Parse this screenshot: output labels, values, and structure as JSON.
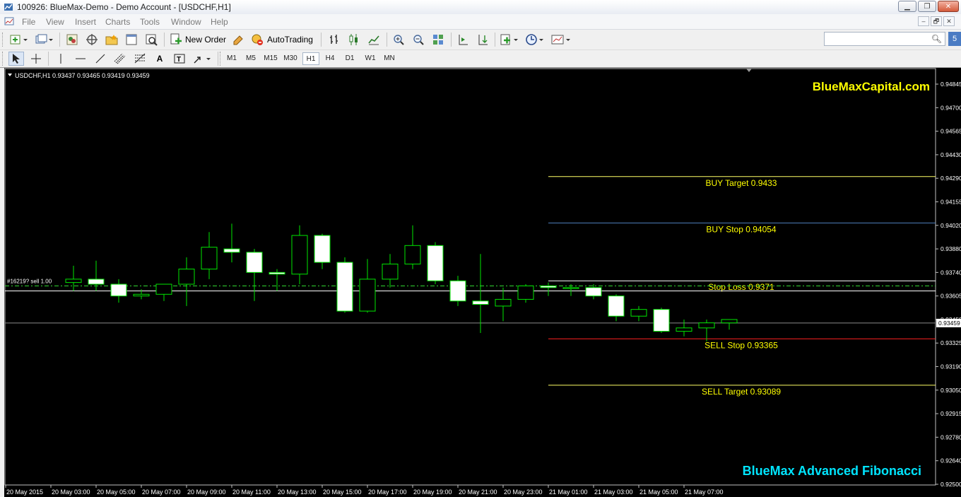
{
  "window": {
    "title": "100926: BlueMax-Demo - Demo Account - [USDCHF,H1]",
    "minimize": "▁",
    "restore": "❐",
    "close": "✕"
  },
  "menu": {
    "items": [
      "File",
      "View",
      "Insert",
      "Charts",
      "Tools",
      "Window",
      "Help"
    ],
    "mdi_buttons": [
      "–",
      "🗗",
      "✕"
    ]
  },
  "toolbar": {
    "new_order_label": "New Order",
    "autotrading_label": "AutoTrading",
    "timeframes": [
      "M1",
      "M5",
      "M15",
      "M30",
      "H1",
      "H4",
      "D1",
      "W1",
      "MN"
    ],
    "active_timeframe": "H1",
    "search_placeholder": "",
    "badge": "5"
  },
  "chart": {
    "header": "USDCHF,H1  0.93437 0.93465 0.93419 0.93459",
    "watermark_top": "BlueMaxCapital.com",
    "watermark_bottom": "BlueMax Advanced Fibonacci",
    "position_label": "#16219? sell 1.00",
    "current_price": "0.93459",
    "colors": {
      "background": "#000000",
      "bull_body": "#000000",
      "bear_body": "#ffffff",
      "wick": "#00e600",
      "buy_target": "#ffff66",
      "buy_stop": "#4f81bd",
      "stop_loss": "#ffffff",
      "sell_stop": "#ff2020",
      "sell_target": "#ffff66",
      "label_text": "#ffff00",
      "watermark_top": "#ffff00",
      "watermark_bottom": "#00e5ff"
    }
  },
  "chart_data": {
    "type": "candlestick",
    "title": "USDCHF,H1",
    "ylim": [
      0.925,
      0.9488
    ],
    "y_ticks": [
      "0.94845",
      "0.94700",
      "0.94565",
      "0.94430",
      "0.94290",
      "0.94155",
      "0.94020",
      "0.93880",
      "0.93740",
      "0.93605",
      "0.93459",
      "0.93325",
      "0.93190",
      "0.93050",
      "0.92915",
      "0.92780",
      "0.92640",
      "0.92500"
    ],
    "x_labels": [
      "20 May 2015",
      "20 May 03:00",
      "20 May 05:00",
      "20 May 07:00",
      "20 May 09:00",
      "20 May 11:00",
      "20 May 13:00",
      "20 May 15:00",
      "20 May 17:00",
      "20 May 19:00",
      "20 May 21:00",
      "20 May 23:00",
      "21 May 01:00",
      "21 May 03:00",
      "21 May 05:00",
      "21 May 07:00"
    ],
    "candles": [
      {
        "o": 0.937,
        "h": 0.938,
        "l": 0.9365,
        "c": 0.9372
      },
      {
        "o": 0.9372,
        "h": 0.9383,
        "l": 0.9365,
        "c": 0.9369
      },
      {
        "o": 0.9369,
        "h": 0.9372,
        "l": 0.9358,
        "c": 0.9362
      },
      {
        "o": 0.9362,
        "h": 0.9366,
        "l": 0.936,
        "c": 0.9363
      },
      {
        "o": 0.9363,
        "h": 0.9369,
        "l": 0.9359,
        "c": 0.9369
      },
      {
        "o": 0.9369,
        "h": 0.9385,
        "l": 0.9356,
        "c": 0.9378
      },
      {
        "o": 0.9378,
        "h": 0.94,
        "l": 0.9372,
        "c": 0.9391
      },
      {
        "o": 0.939,
        "h": 0.9405,
        "l": 0.9382,
        "c": 0.9388
      },
      {
        "o": 0.9388,
        "h": 0.939,
        "l": 0.9359,
        "c": 0.9376
      },
      {
        "o": 0.9376,
        "h": 0.9378,
        "l": 0.9365,
        "c": 0.9375
      },
      {
        "o": 0.9375,
        "h": 0.9404,
        "l": 0.9369,
        "c": 0.9398
      },
      {
        "o": 0.9398,
        "h": 0.9399,
        "l": 0.9378,
        "c": 0.9382
      },
      {
        "o": 0.9382,
        "h": 0.9385,
        "l": 0.9352,
        "c": 0.9353
      },
      {
        "o": 0.9353,
        "h": 0.9384,
        "l": 0.9352,
        "c": 0.9372
      },
      {
        "o": 0.9372,
        "h": 0.9387,
        "l": 0.9367,
        "c": 0.9381
      },
      {
        "o": 0.9381,
        "h": 0.9404,
        "l": 0.9378,
        "c": 0.9392
      },
      {
        "o": 0.9392,
        "h": 0.9394,
        "l": 0.9369,
        "c": 0.9371
      },
      {
        "o": 0.9371,
        "h": 0.9374,
        "l": 0.9356,
        "c": 0.9359
      },
      {
        "o": 0.9359,
        "h": 0.9387,
        "l": 0.934,
        "c": 0.9357
      },
      {
        "o": 0.9356,
        "h": 0.9367,
        "l": 0.9347,
        "c": 0.936
      },
      {
        "o": 0.936,
        "h": 0.9369,
        "l": 0.9358,
        "c": 0.9368
      },
      {
        "o": 0.9368,
        "h": 0.937,
        "l": 0.9362,
        "c": 0.9367
      },
      {
        "o": 0.9367,
        "h": 0.9369,
        "l": 0.9362,
        "c": 0.9367
      },
      {
        "o": 0.9367,
        "h": 0.9369,
        "l": 0.936,
        "c": 0.9362
      },
      {
        "o": 0.9362,
        "h": 0.9363,
        "l": 0.9347,
        "c": 0.935
      },
      {
        "o": 0.935,
        "h": 0.9356,
        "l": 0.9347,
        "c": 0.9354
      },
      {
        "o": 0.9354,
        "h": 0.9355,
        "l": 0.934,
        "c": 0.9341
      },
      {
        "o": 0.9341,
        "h": 0.9348,
        "l": 0.9338,
        "c": 0.9343
      },
      {
        "o": 0.9343,
        "h": 0.9348,
        "l": 0.9335,
        "c": 0.9346
      },
      {
        "o": 0.9346,
        "h": 0.9348,
        "l": 0.9342,
        "c": 0.9348
      }
    ],
    "levels": [
      {
        "name": "buy_target",
        "label": "BUY Target  0.9433",
        "value": 0.9433
      },
      {
        "name": "buy_stop",
        "label": "BUY Stop   0.94054",
        "value": 0.94054
      },
      {
        "name": "stop_loss",
        "label": "Stop Loss   0.9371",
        "value": 0.9371
      },
      {
        "name": "sell_stop",
        "label": "SELL Stop   0.93365",
        "value": 0.93365
      },
      {
        "name": "sell_target",
        "label": "SELL Target 0.93089",
        "value": 0.93089
      }
    ],
    "position_price": 0.9365,
    "trade_line_price": 0.9368,
    "current_price": 0.93459
  }
}
